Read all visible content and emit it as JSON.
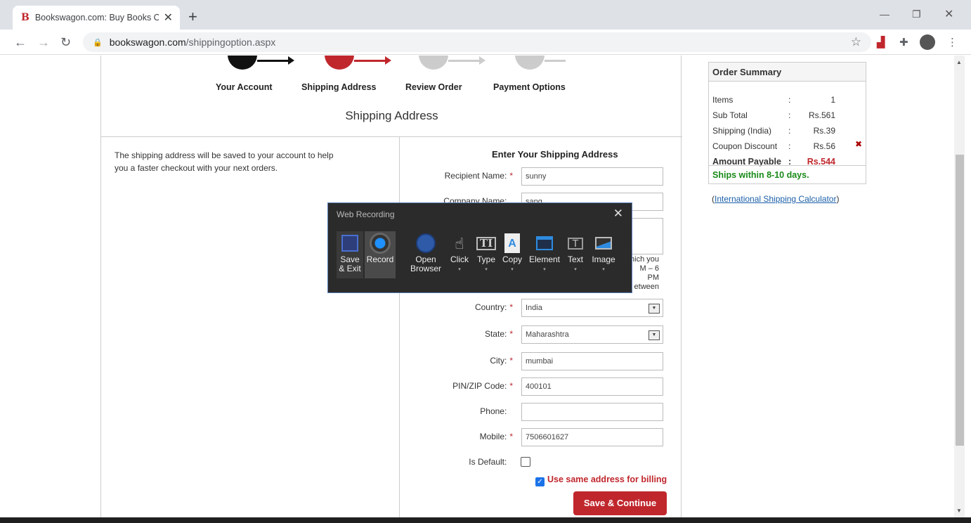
{
  "browser": {
    "tab_title": "Bookswagon.com: Buy Books On",
    "favicon": "B",
    "url_domain": "bookswagon.com",
    "url_path": "/shippingoption.aspx"
  },
  "steps": {
    "account": "Your Account",
    "shipping": "Shipping Address",
    "review": "Review Order",
    "payment": "Payment Options"
  },
  "page_title": "Shipping Address",
  "info_text_1": "The shipping address will be saved to your account to help",
  "info_text_2": "you a faster checkout with your next orders.",
  "form": {
    "title": "Enter Your Shipping Address",
    "recipient_label": "Recipient Name:",
    "recipient_value": "sunny",
    "company_label": "Company Name:",
    "company_value": "sapg",
    "note_1": "hich you",
    "note_2": "M – 6 PM",
    "note_3": "etween",
    "country_label": "Country:",
    "country_value": "India",
    "state_label": "State:",
    "state_value": "Maharashtra",
    "city_label": "City:",
    "city_value": "mumbai",
    "pin_label": "PIN/ZIP Code:",
    "pin_value": "400101",
    "phone_label": "Phone:",
    "phone_value": "",
    "mobile_label": "Mobile:",
    "mobile_value": "7506601627",
    "default_label": "Is Default:",
    "is_default": false,
    "billing_label": "Use same address for billing",
    "billing_checked": true,
    "save_button": "Save & Continue",
    "required_mark": "*"
  },
  "summary": {
    "title": "Order Summary",
    "rows": [
      {
        "label": "Items",
        "sep": ":",
        "value": "1"
      },
      {
        "label": "Sub Total",
        "sep": ":",
        "value": "Rs.561"
      },
      {
        "label": "Shipping (India)",
        "sep": ":",
        "value": "Rs.39"
      },
      {
        "label": "Coupon Discount",
        "sep": ":",
        "value": "Rs.56"
      }
    ],
    "payable_label": "Amount Payable",
    "payable_sep": ":",
    "payable_value": "Rs.544",
    "ships": "Ships within 8-10 days.",
    "calc_open": "(",
    "calc_link": "International Shipping Calculator",
    "calc_close": ")"
  },
  "recorder": {
    "title": "Web Recording",
    "buttons": {
      "save_1": "Save",
      "save_2": "& Exit",
      "record": "Record",
      "open_1": "Open",
      "open_2": "Browser",
      "click": "Click",
      "type": "Type",
      "copy": "Copy",
      "element": "Element",
      "text": "Text",
      "image": "Image"
    }
  },
  "colors": {
    "accent": "#c0272d",
    "success": "#1a8a1a",
    "link": "#1a5fa8"
  }
}
